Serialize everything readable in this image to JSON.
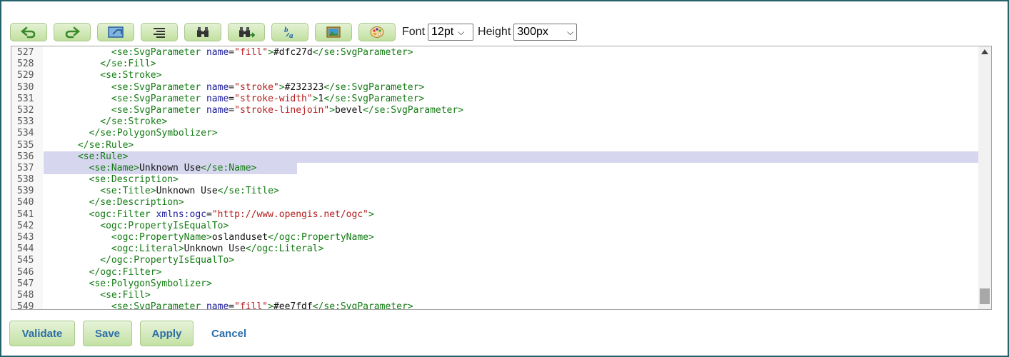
{
  "toolbar": {
    "buttons": [
      {
        "icon": "undo-icon"
      },
      {
        "icon": "redo-icon"
      },
      {
        "icon": "fullscreen-icon"
      },
      {
        "icon": "format-align-icon"
      },
      {
        "icon": "search-icon"
      },
      {
        "icon": "search-replace-icon"
      },
      {
        "icon": "font-size-icon"
      },
      {
        "icon": "picture-icon"
      },
      {
        "icon": "palette-icon"
      }
    ],
    "font_label": "Font",
    "font_value": "12pt",
    "height_label": "Height",
    "height_value": "300px"
  },
  "editor": {
    "lines": [
      {
        "n": "527",
        "code": "            <se:SvgParameter name=\"fill\">#dfc27d</se:SvgParameter>"
      },
      {
        "n": "528",
        "code": "          </se:Fill>"
      },
      {
        "n": "529",
        "code": "          <se:Stroke>"
      },
      {
        "n": "530",
        "code": "            <se:SvgParameter name=\"stroke\">#232323</se:SvgParameter>"
      },
      {
        "n": "531",
        "code": "            <se:SvgParameter name=\"stroke-width\">1</se:SvgParameter>"
      },
      {
        "n": "532",
        "code": "            <se:SvgParameter name=\"stroke-linejoin\">bevel</se:SvgParameter>"
      },
      {
        "n": "533",
        "code": "          </se:Stroke>"
      },
      {
        "n": "534",
        "code": "        </se:PolygonSymbolizer>"
      },
      {
        "n": "535",
        "code": "      </se:Rule>"
      },
      {
        "n": "536",
        "code": "      <se:Rule>"
      },
      {
        "n": "537",
        "code": "        <se:Name>Unknown Use</se:Name>"
      },
      {
        "n": "538",
        "code": "        <se:Description>"
      },
      {
        "n": "539",
        "code": "          <se:Title>Unknown Use</se:Title>"
      },
      {
        "n": "540",
        "code": "        </se:Description>"
      },
      {
        "n": "541",
        "code": "        <ogc:Filter xmlns:ogc=\"http://www.opengis.net/ogc\">"
      },
      {
        "n": "542",
        "code": "          <ogc:PropertyIsEqualTo>"
      },
      {
        "n": "543",
        "code": "            <ogc:PropertyName>oslanduset</ogc:PropertyName>"
      },
      {
        "n": "544",
        "code": "            <ogc:Literal>Unknown Use</ogc:Literal>"
      },
      {
        "n": "545",
        "code": "          </ogc:PropertyIsEqualTo>"
      },
      {
        "n": "546",
        "code": "        </ogc:Filter>"
      },
      {
        "n": "547",
        "code": "        <se:PolygonSymbolizer>"
      },
      {
        "n": "548",
        "code": "          <se:Fill>"
      },
      {
        "n": "549",
        "code": "            <se:SvgParameter name=\"fill\">#ee7fdf</se:SvgParameter>"
      }
    ],
    "selected_lines": [
      "536",
      "537"
    ]
  },
  "actions": {
    "validate": "Validate",
    "save": "Save",
    "apply": "Apply",
    "cancel": "Cancel"
  },
  "colors": {
    "tag": "#127a12",
    "attribute": "#1a1a9b",
    "value": "#b51d1d",
    "selection": "#d6d6ef",
    "button_text": "#2d6ea8",
    "frame": "#24636b"
  }
}
